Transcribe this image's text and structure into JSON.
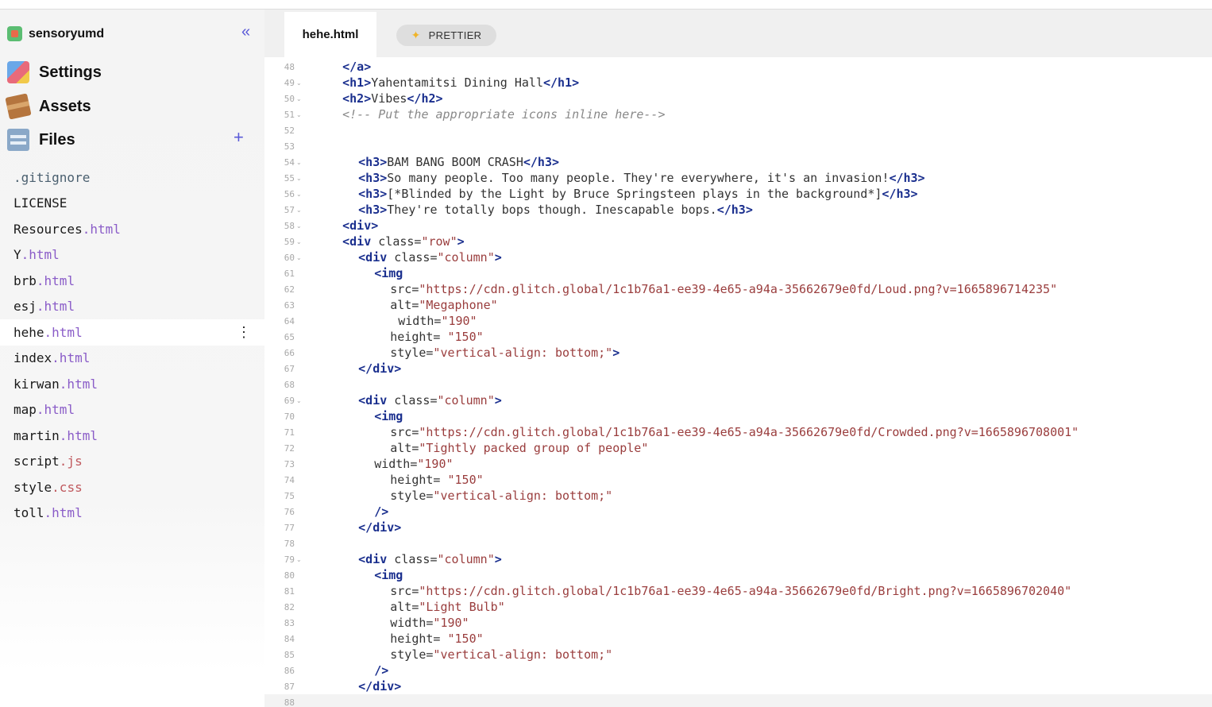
{
  "project": {
    "name": "sensoryumd"
  },
  "nav": {
    "settings": "Settings",
    "assets": "Assets",
    "files": "Files"
  },
  "files": [
    {
      "base": ".gitignore",
      "ext": ""
    },
    {
      "base": "LICENSE",
      "ext": ""
    },
    {
      "base": "Resources",
      "ext": ".html"
    },
    {
      "base": "Y",
      "ext": ".html"
    },
    {
      "base": "brb",
      "ext": ".html"
    },
    {
      "base": "esj",
      "ext": ".html"
    },
    {
      "base": "hehe",
      "ext": ".html"
    },
    {
      "base": "index",
      "ext": ".html"
    },
    {
      "base": "kirwan",
      "ext": ".html"
    },
    {
      "base": "map",
      "ext": ".html"
    },
    {
      "base": "martin",
      "ext": ".html"
    },
    {
      "base": "script",
      "ext": ".js"
    },
    {
      "base": "style",
      "ext": ".css"
    },
    {
      "base": "toll",
      "ext": ".html"
    }
  ],
  "active_file": "hehe.html",
  "tab": {
    "label": "hehe.html"
  },
  "prettier": {
    "label": "PRETTIER"
  },
  "code_lines": [
    {
      "n": "48",
      "fold": false,
      "indent": 6,
      "parts": [
        [
          "tag",
          "</a>"
        ]
      ]
    },
    {
      "n": "49",
      "fold": true,
      "indent": 6,
      "parts": [
        [
          "tag",
          "<h1>"
        ],
        [
          "txt",
          "Yahentamitsi Dining Hall"
        ],
        [
          "tag",
          "</h1>"
        ]
      ]
    },
    {
      "n": "50",
      "fold": true,
      "indent": 6,
      "parts": [
        [
          "tag",
          "<h2>"
        ],
        [
          "txt",
          "Vibes"
        ],
        [
          "tag",
          "</h2>"
        ]
      ]
    },
    {
      "n": "51",
      "fold": true,
      "indent": 6,
      "parts": [
        [
          "cmt",
          "<!-- Put the appropriate icons inline here-->"
        ]
      ]
    },
    {
      "n": "52",
      "fold": false,
      "indent": 0,
      "parts": []
    },
    {
      "n": "53",
      "fold": false,
      "indent": 0,
      "parts": []
    },
    {
      "n": "54",
      "fold": true,
      "indent": 8,
      "parts": [
        [
          "tag",
          "<h3>"
        ],
        [
          "txt",
          "BAM BANG BOOM CRASH"
        ],
        [
          "tag",
          "</h3>"
        ]
      ]
    },
    {
      "n": "55",
      "fold": true,
      "indent": 8,
      "parts": [
        [
          "tag",
          "<h3>"
        ],
        [
          "txt",
          "So many people. Too many people. They're everywhere, it's an invasion!"
        ],
        [
          "tag",
          "</h3>"
        ]
      ]
    },
    {
      "n": "56",
      "fold": true,
      "indent": 8,
      "parts": [
        [
          "tag",
          "<h3>"
        ],
        [
          "txt",
          "[*Blinded by the Light by Bruce Springsteen plays in the background*]"
        ],
        [
          "tag",
          "</h3>"
        ]
      ]
    },
    {
      "n": "57",
      "fold": true,
      "indent": 8,
      "parts": [
        [
          "tag",
          "<h3>"
        ],
        [
          "txt",
          "They're totally bops though. Inescapable bops."
        ],
        [
          "tag",
          "</h3>"
        ]
      ]
    },
    {
      "n": "58",
      "fold": true,
      "indent": 6,
      "parts": [
        [
          "tag",
          "<div>"
        ]
      ]
    },
    {
      "n": "59",
      "fold": true,
      "indent": 6,
      "parts": [
        [
          "tag",
          "<div"
        ],
        [
          "txt",
          " class="
        ],
        [
          "str",
          "\"row\""
        ],
        [
          "tag",
          ">"
        ]
      ]
    },
    {
      "n": "60",
      "fold": true,
      "indent": 8,
      "parts": [
        [
          "tag",
          "<div"
        ],
        [
          "txt",
          " class="
        ],
        [
          "str",
          "\"column\""
        ],
        [
          "tag",
          ">"
        ]
      ]
    },
    {
      "n": "61",
      "fold": false,
      "indent": 10,
      "parts": [
        [
          "tag",
          "<img"
        ]
      ]
    },
    {
      "n": "62",
      "fold": false,
      "indent": 12,
      "parts": [
        [
          "txt",
          "src="
        ],
        [
          "str",
          "\"https://cdn.glitch.global/1c1b76a1-ee39-4e65-a94a-35662679e0fd/Loud.png?v=1665896714235\""
        ]
      ]
    },
    {
      "n": "63",
      "fold": false,
      "indent": 12,
      "parts": [
        [
          "txt",
          "alt="
        ],
        [
          "str",
          "\"Megaphone\""
        ]
      ]
    },
    {
      "n": "64",
      "fold": false,
      "indent": 13,
      "parts": [
        [
          "txt",
          "width="
        ],
        [
          "str",
          "\"190\""
        ]
      ]
    },
    {
      "n": "65",
      "fold": false,
      "indent": 12,
      "parts": [
        [
          "txt",
          "height= "
        ],
        [
          "str",
          "\"150\""
        ]
      ]
    },
    {
      "n": "66",
      "fold": false,
      "indent": 12,
      "parts": [
        [
          "txt",
          "style="
        ],
        [
          "str",
          "\"vertical-align: bottom;\""
        ],
        [
          "tag",
          ">"
        ]
      ]
    },
    {
      "n": "67",
      "fold": false,
      "indent": 8,
      "parts": [
        [
          "tag",
          "</div>"
        ]
      ]
    },
    {
      "n": "68",
      "fold": false,
      "indent": 0,
      "parts": []
    },
    {
      "n": "69",
      "fold": true,
      "indent": 8,
      "parts": [
        [
          "tag",
          "<div"
        ],
        [
          "txt",
          " class="
        ],
        [
          "str",
          "\"column\""
        ],
        [
          "tag",
          ">"
        ]
      ]
    },
    {
      "n": "70",
      "fold": false,
      "indent": 10,
      "parts": [
        [
          "tag",
          "<img"
        ]
      ]
    },
    {
      "n": "71",
      "fold": false,
      "indent": 12,
      "parts": [
        [
          "txt",
          "src="
        ],
        [
          "str",
          "\"https://cdn.glitch.global/1c1b76a1-ee39-4e65-a94a-35662679e0fd/Crowded.png?v=1665896708001\""
        ]
      ]
    },
    {
      "n": "72",
      "fold": false,
      "indent": 12,
      "parts": [
        [
          "txt",
          "alt="
        ],
        [
          "str",
          "\"Tightly packed group of people\""
        ]
      ]
    },
    {
      "n": "73",
      "fold": false,
      "indent": 10,
      "parts": [
        [
          "txt",
          "width="
        ],
        [
          "str",
          "\"190\""
        ]
      ]
    },
    {
      "n": "74",
      "fold": false,
      "indent": 12,
      "parts": [
        [
          "txt",
          "height= "
        ],
        [
          "str",
          "\"150\""
        ]
      ]
    },
    {
      "n": "75",
      "fold": false,
      "indent": 12,
      "parts": [
        [
          "txt",
          "style="
        ],
        [
          "str",
          "\"vertical-align: bottom;\""
        ]
      ]
    },
    {
      "n": "76",
      "fold": false,
      "indent": 10,
      "parts": [
        [
          "tag",
          "/>"
        ]
      ]
    },
    {
      "n": "77",
      "fold": false,
      "indent": 8,
      "parts": [
        [
          "tag",
          "</div>"
        ]
      ]
    },
    {
      "n": "78",
      "fold": false,
      "indent": 0,
      "parts": []
    },
    {
      "n": "79",
      "fold": true,
      "indent": 8,
      "parts": [
        [
          "tag",
          "<div"
        ],
        [
          "txt",
          " class="
        ],
        [
          "str",
          "\"column\""
        ],
        [
          "tag",
          ">"
        ]
      ]
    },
    {
      "n": "80",
      "fold": false,
      "indent": 10,
      "parts": [
        [
          "tag",
          "<img"
        ]
      ]
    },
    {
      "n": "81",
      "fold": false,
      "indent": 12,
      "parts": [
        [
          "txt",
          "src="
        ],
        [
          "str",
          "\"https://cdn.glitch.global/1c1b76a1-ee39-4e65-a94a-35662679e0fd/Bright.png?v=1665896702040\""
        ]
      ]
    },
    {
      "n": "82",
      "fold": false,
      "indent": 12,
      "parts": [
        [
          "txt",
          "alt="
        ],
        [
          "str",
          "\"Light Bulb\""
        ]
      ]
    },
    {
      "n": "83",
      "fold": false,
      "indent": 12,
      "parts": [
        [
          "txt",
          "width="
        ],
        [
          "str",
          "\"190\""
        ]
      ]
    },
    {
      "n": "84",
      "fold": false,
      "indent": 12,
      "parts": [
        [
          "txt",
          "height= "
        ],
        [
          "str",
          "\"150\""
        ]
      ]
    },
    {
      "n": "85",
      "fold": false,
      "indent": 12,
      "parts": [
        [
          "txt",
          "style="
        ],
        [
          "str",
          "\"vertical-align: bottom;\""
        ]
      ]
    },
    {
      "n": "86",
      "fold": false,
      "indent": 10,
      "parts": [
        [
          "tag",
          "/>"
        ]
      ]
    },
    {
      "n": "87",
      "fold": false,
      "indent": 8,
      "parts": [
        [
          "tag",
          "</div>"
        ]
      ]
    },
    {
      "n": "88",
      "fold": false,
      "indent": 0,
      "parts": [],
      "current": true
    }
  ]
}
